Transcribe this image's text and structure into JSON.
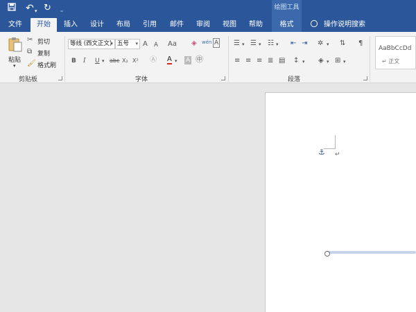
{
  "quick_access": {
    "save_icon": "save-icon",
    "undo_icon": "undo-icon",
    "redo_icon": "redo-icon",
    "customize_icon": "customize-qat-icon"
  },
  "context_title": "绘图工具",
  "tabs": [
    "文件",
    "开始",
    "插入",
    "设计",
    "布局",
    "引用",
    "邮件",
    "审阅",
    "视图",
    "帮助",
    "格式"
  ],
  "active_tab": "开始",
  "tell_me": "操作说明搜索",
  "clipboard": {
    "paste": "粘贴",
    "cut": "剪切",
    "copy": "复制",
    "format_painter": "格式刷",
    "group": "剪贴板"
  },
  "font": {
    "name": "等线 (西文正文)",
    "size": "五号",
    "group": "字体",
    "bold": "B",
    "italic": "I",
    "underline": "U",
    "strike": "abc",
    "subscript": "X₂",
    "superscript": "X²",
    "grow": "A",
    "shrink": "A",
    "case": "Aa",
    "font_color": "A",
    "highlight": "A",
    "char_shading": "A",
    "phonetic": "wén"
  },
  "paragraph": {
    "group": "段落"
  },
  "styles": {
    "preview": "AaBbCcDd",
    "name": "正文"
  },
  "document": {
    "paragraph_mark": "↵",
    "anchor_icon": "anchor-icon"
  }
}
